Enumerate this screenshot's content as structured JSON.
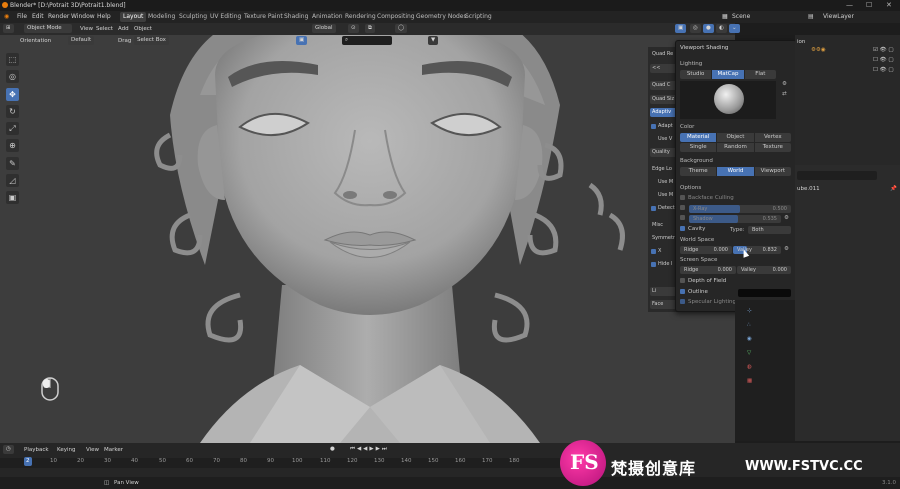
{
  "titlebar": {
    "title": "Blender* [D:\\Potrait 3D\\Potrait1.blend]",
    "min": "—",
    "max": "☐",
    "close": "✕"
  },
  "menubar": {
    "menus": [
      "File",
      "Edit",
      "Render",
      "Window",
      "Help"
    ],
    "workspaces": [
      "Layout",
      "Modeling",
      "Sculpting",
      "UV Editing",
      "Texture Paint",
      "Shading",
      "Animation",
      "Rendering",
      "Compositing",
      "Geometry Nodes",
      "Scripting"
    ],
    "active_workspace": "Layout",
    "scene": "Scene",
    "view_layer": "ViewLayer"
  },
  "viewport_header": {
    "mode": "Object Mode",
    "menus": [
      "View",
      "Select",
      "Add",
      "Object"
    ],
    "transform_orientation": "Global",
    "orientation_label": "Orientation",
    "orientation_value": "Default",
    "drag_label": "Drag",
    "drag_value": "Select Box"
  },
  "npanel": {
    "items": [
      "Quad Re",
      "<<",
      "Quad C",
      "Quad Siz",
      "Adaptiv",
      "Adapt",
      "Use V",
      "Quality",
      "Edge Lo",
      "Use M",
      "Use M",
      "Detect",
      "Misc",
      "Symmetr",
      "X",
      "Hide I",
      "Li",
      "Face"
    ]
  },
  "shading": {
    "title": "Viewport Shading",
    "lighting_label": "Lighting",
    "lighting_options": [
      "Studio",
      "MatCap",
      "Flat"
    ],
    "lighting_active": "MatCap",
    "color_label": "Color",
    "color_options_row1": [
      "Material",
      "Object",
      "Vertex"
    ],
    "color_options_row2": [
      "Single",
      "Random",
      "Texture"
    ],
    "color_active": "Material",
    "background_label": "Background",
    "background_options": [
      "Theme",
      "World",
      "Viewport"
    ],
    "background_active": "World",
    "options_label": "Options",
    "backface_culling": "Backface Culling",
    "xray_label": "X-Ray",
    "xray_value": "0.500",
    "shadow_label": "Shadow",
    "shadow_value": "0.535",
    "cavity_label": "Cavity",
    "cavity_type_label": "Type:",
    "cavity_type_value": "Both",
    "world_space_label": "World Space",
    "ws_ridge_label": "Ridge",
    "ws_ridge_value": "0.000",
    "ws_valley_label": "Valley",
    "ws_valley_value": "0.832",
    "screen_space_label": "Screen Space",
    "ss_ridge_label": "Ridge",
    "ss_ridge_value": "0.000",
    "ss_valley_label": "Valley",
    "ss_valley_value": "0.000",
    "depth_of_field": "Depth of Field",
    "outline": "Outline",
    "specular": "Specular Lighting"
  },
  "outliner": {
    "row1": "ion",
    "object_name": "ube.011"
  },
  "timeline": {
    "menus": [
      "Playback",
      "Keying",
      "View",
      "Marker"
    ],
    "current_frame": "2",
    "ticks": [
      "10",
      "20",
      "30",
      "40",
      "50",
      "60",
      "70",
      "80",
      "90",
      "100",
      "110",
      "120",
      "130",
      "140",
      "150",
      "160",
      "170",
      "180"
    ]
  },
  "statusbar": {
    "pan_view": "Pan View",
    "version": "3.1.0"
  },
  "watermark": {
    "logo": "FS",
    "text": "梵摄创意库",
    "url": "WWW.FSTVC.CC"
  }
}
